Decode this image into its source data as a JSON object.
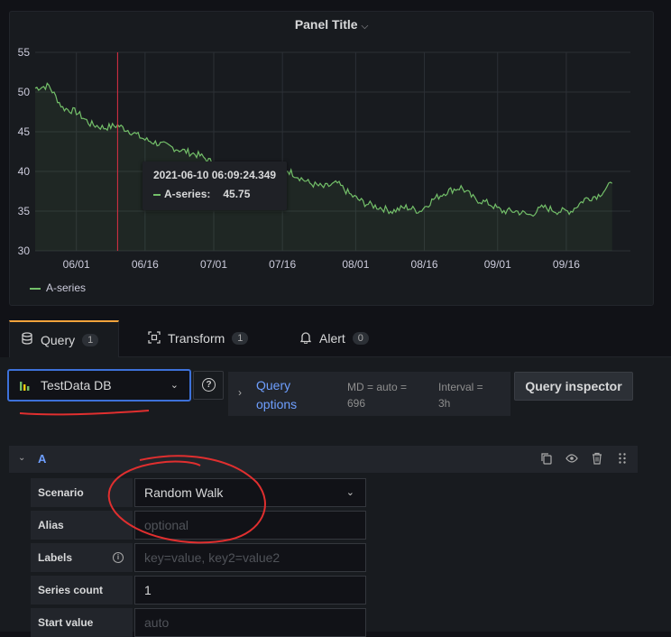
{
  "panel": {
    "title": "Panel Title"
  },
  "tooltip": {
    "time": "2021-06-10 06:09:24.349",
    "series": "A-series:",
    "value": "45.75"
  },
  "tabs": [
    {
      "label": "Query",
      "count": "1"
    },
    {
      "label": "Transform",
      "count": "1"
    },
    {
      "label": "Alert",
      "count": "0"
    }
  ],
  "datasource": {
    "name": "TestData DB"
  },
  "query_options": {
    "label": "Query options",
    "md": "MD = auto = 696",
    "interval": "Interval = 3h"
  },
  "query_inspector": "Query inspector",
  "query_row": {
    "name": "A"
  },
  "fields": {
    "scenario": {
      "label": "Scenario",
      "value": "Random Walk"
    },
    "alias": {
      "label": "Alias",
      "placeholder": "optional"
    },
    "labels": {
      "label": "Labels",
      "placeholder": "key=value, key2=value2"
    },
    "series_count": {
      "label": "Series count",
      "value": "1"
    },
    "start_value": {
      "label": "Start value",
      "placeholder": "auto"
    }
  },
  "colors": {
    "series": "#73bf69",
    "accent": "#6e9fff",
    "active_tab": "#f1a33c",
    "annotation": "#e02f44",
    "focus": "#3d71d9"
  },
  "chart_data": {
    "type": "line",
    "title": "Panel Title",
    "ylim": [
      30,
      55
    ],
    "y_ticks": [
      "30",
      "35",
      "40",
      "45",
      "50",
      "55"
    ],
    "x_ticks": [
      "06/01",
      "06/16",
      "07/01",
      "07/16",
      "08/01",
      "08/16",
      "09/01",
      "09/16"
    ],
    "grid": true,
    "legend": "bottom-left",
    "series": [
      {
        "name": "A-series",
        "x": [
          "05/23",
          "05/26",
          "05/29",
          "06/01",
          "06/04",
          "06/07",
          "06/10",
          "06/13",
          "06/16",
          "06/19",
          "06/22",
          "06/25",
          "06/28",
          "07/01",
          "07/04",
          "07/07",
          "07/10",
          "07/13",
          "07/16",
          "07/19",
          "07/22",
          "07/25",
          "07/28",
          "07/31",
          "08/03",
          "08/06",
          "08/09",
          "08/12",
          "08/15",
          "08/18",
          "08/21",
          "08/24",
          "08/27",
          "08/30",
          "09/02",
          "09/05",
          "09/08",
          "09/11",
          "09/14",
          "09/17",
          "09/20",
          "09/23",
          "09/26"
        ],
        "values": [
          50.5,
          50.8,
          48,
          47.5,
          46,
          45.5,
          45.8,
          45,
          44,
          43.5,
          43,
          42.5,
          42,
          41,
          40,
          39.5,
          40,
          41,
          40.5,
          39.5,
          38.5,
          38,
          38.5,
          37,
          36,
          35.5,
          35,
          35.5,
          35,
          36.5,
          37.5,
          38,
          36.5,
          36,
          35,
          35,
          34.5,
          35.5,
          35,
          35,
          36.5,
          37,
          38.5
        ]
      }
    ]
  }
}
